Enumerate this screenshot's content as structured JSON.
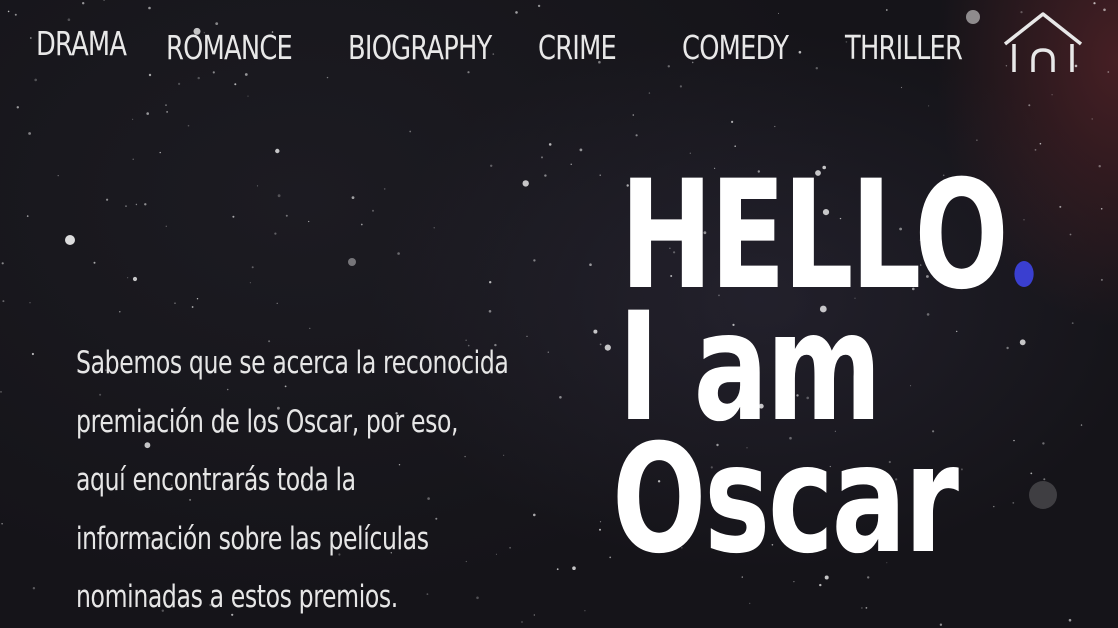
{
  "nav": {
    "items": [
      {
        "id": "drama",
        "label": "DRAMA"
      },
      {
        "id": "romance",
        "label": "ROMANCE"
      },
      {
        "id": "biography",
        "label": "BIOGRAPHY"
      },
      {
        "id": "crime",
        "label": "CRIME"
      },
      {
        "id": "comedy",
        "label": "COMEDY"
      },
      {
        "id": "thriller",
        "label": "THRILLER"
      }
    ],
    "home_icon": "home-icon"
  },
  "intro": {
    "lines": [
      "Sabemos que se acerca la reconocida",
      "premiación de los Oscar, por eso,",
      "aquí encontrarás toda la",
      "información sobre las películas",
      "nominadas a estos premios."
    ]
  },
  "hero": {
    "line1": "HELLO",
    "line2": "I am",
    "line3": "Oscar"
  },
  "colors": {
    "accent_dot": "#3a3fd0",
    "text": "#ffffff"
  }
}
